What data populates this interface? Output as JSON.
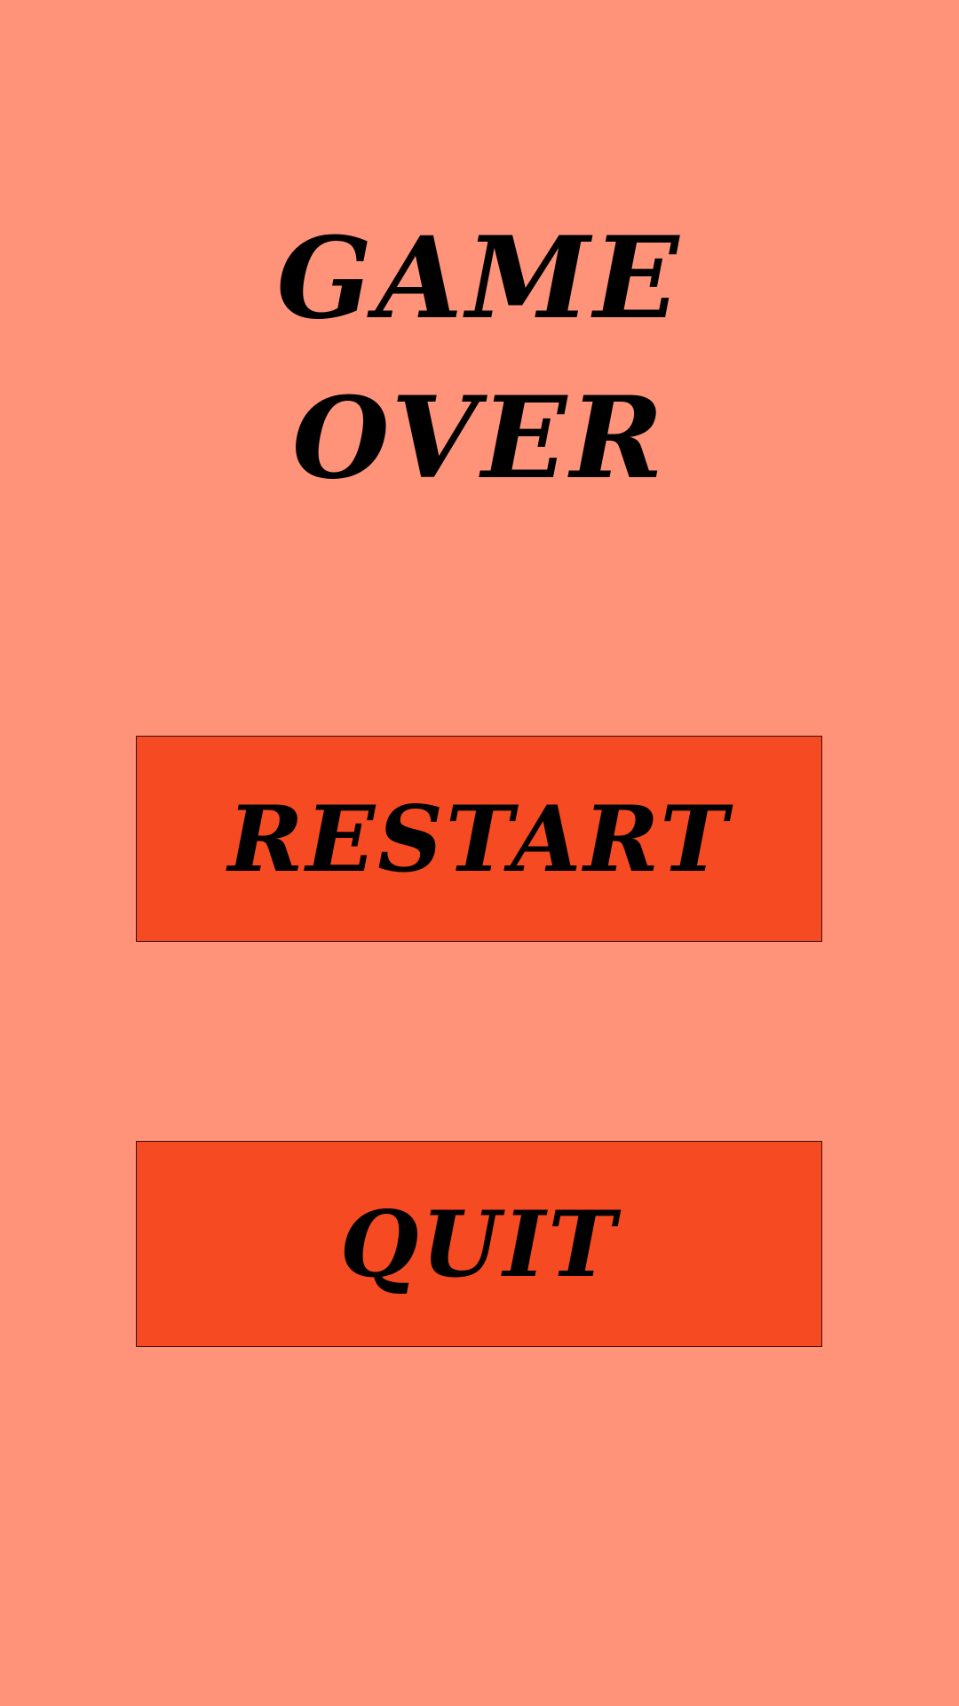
{
  "screen": {
    "title_line_1": "GAME",
    "title_line_2": "OVER"
  },
  "buttons": {
    "restart_label": "RESTART",
    "quit_label": "QUIT"
  },
  "colors": {
    "background": "#ff937a",
    "button_fill": "#f64a22",
    "text": "#000000"
  }
}
